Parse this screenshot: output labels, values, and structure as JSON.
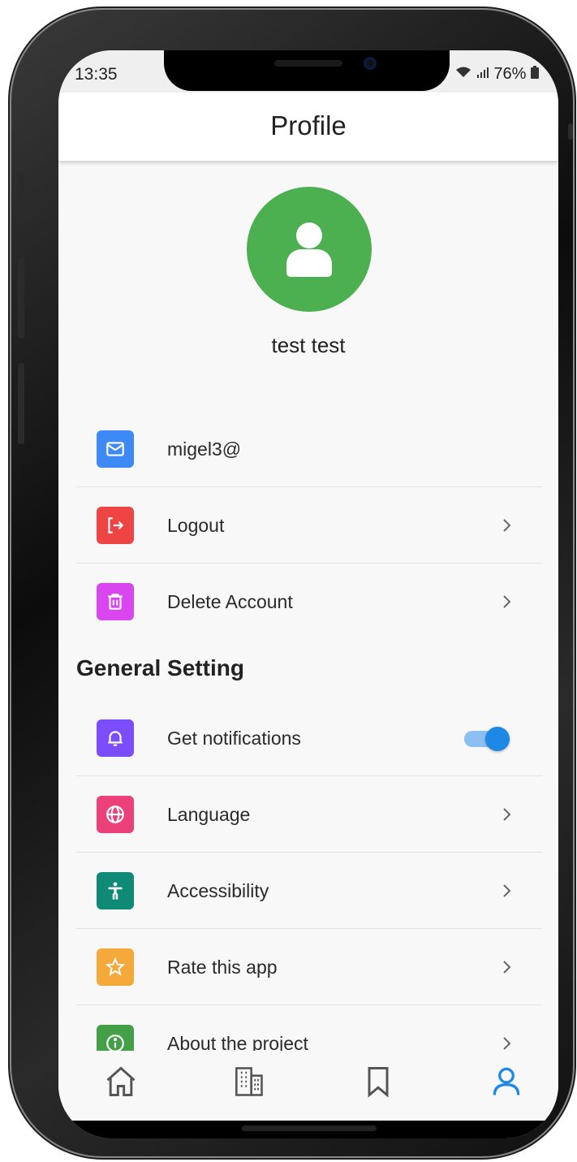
{
  "status_bar": {
    "time": "13:35",
    "battery": "76%"
  },
  "app_bar": {
    "title": "Profile"
  },
  "profile": {
    "name": "test test"
  },
  "account_items": [
    {
      "label": "migel3@",
      "icon": "mail-icon",
      "color": "#3d8af7",
      "chevron": false
    },
    {
      "label": "Logout",
      "icon": "logout-icon",
      "color": "#ef4444",
      "chevron": true
    },
    {
      "label": "Delete Account",
      "icon": "trash-icon",
      "color": "#d946ef",
      "chevron": true
    }
  ],
  "general_setting": {
    "title": "General Setting",
    "items": [
      {
        "label": "Get notifications",
        "icon": "bell-icon",
        "color": "#7c4dff",
        "toggle": true,
        "toggle_on": true
      },
      {
        "label": "Language",
        "icon": "globe-icon",
        "color": "#ec407a",
        "chevron": true
      },
      {
        "label": "Accessibility",
        "icon": "accessibility-icon",
        "color": "#0f8a76",
        "chevron": true
      },
      {
        "label": "Rate this app",
        "icon": "star-icon",
        "color": "#f6a93b",
        "chevron": true
      },
      {
        "label": "About the project",
        "icon": "info-icon",
        "color": "#43a047",
        "chevron": true
      }
    ]
  },
  "bottom_nav": {
    "items": [
      {
        "icon": "home-icon",
        "active": false
      },
      {
        "icon": "building-icon",
        "active": false
      },
      {
        "icon": "bookmark-icon",
        "active": false
      },
      {
        "icon": "person-icon",
        "active": true
      }
    ],
    "active_color": "#1e88e5",
    "inactive_color": "#555555"
  }
}
